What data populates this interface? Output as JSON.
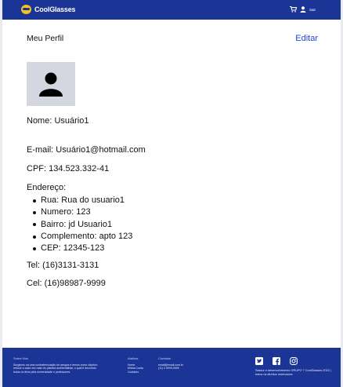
{
  "header": {
    "logo_text": "CoolGlasses",
    "logout_label": "Sair",
    "cart_icon": "cart-icon",
    "user_icon": "user-icon"
  },
  "profile": {
    "title": "Meu Perfil",
    "edit_label": "Editar",
    "avatar_icon": "user-silhouette-icon",
    "name": "Nome: Usuário1",
    "email": "E-mail: Usuário1@hotmail.com",
    "cpf": "CPF: 134.523.332-41",
    "address_label": "Endereço:",
    "address": [
      "Rua: Rua do usuario1",
      "Numero: 123",
      "Bairro: jd Usuario1",
      "Complemento: apto 123",
      "CEP: 12345-123"
    ],
    "tel": "Tel: (16)3131-3131",
    "cel": "Cel: (16)98987-9999"
  },
  "footer": {
    "about_heading": "Sobre Nós",
    "about_text": "Surgimos na uma confraternização de amigos e temos como objetivo reduzir a cada vez mais do planeta ambientalista, o qual é decorrido todos os itens pela universidade e professores.",
    "links_heading": "Atalhos",
    "links": [
      "Home",
      "Minha Conta",
      "Contatos"
    ],
    "contact_heading": "Contatos",
    "contacts": [
      "email@email.com.br",
      "(11) 4 0909-0909"
    ],
    "copyright": "Sassor e desenvolvimento GRUPO 7 CoolGlasses 2023 | todos os direitos reservados",
    "social_icons": [
      "twitter-icon",
      "facebook-icon",
      "instagram-icon"
    ],
    "colors": {
      "brand": "#1b3597",
      "accent": "#2343d6",
      "logo": "#f6c21c"
    }
  }
}
